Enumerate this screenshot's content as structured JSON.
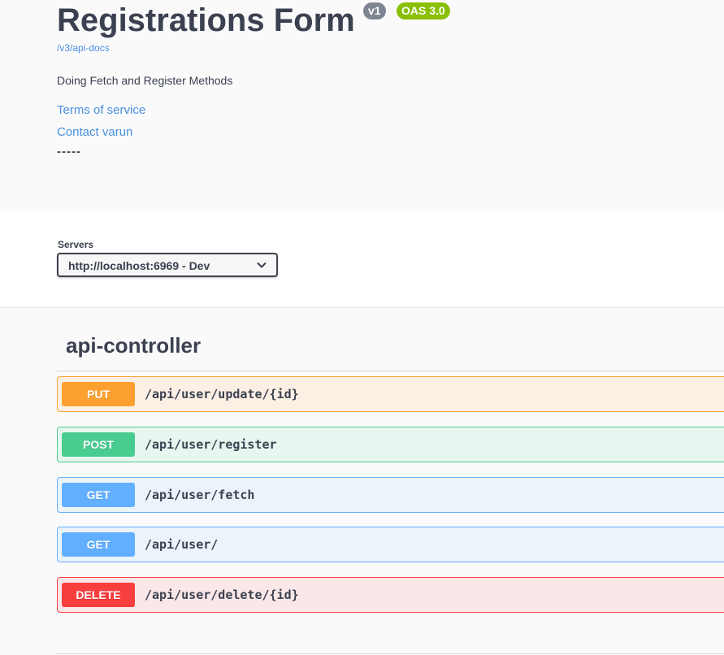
{
  "info": {
    "title": "Registrations Form",
    "version_badge": "v1",
    "oas_badge": "OAS 3.0",
    "docs_link": "/v3/api-docs",
    "description": "Doing Fetch and Register Methods",
    "terms_link": "Terms of service",
    "contact_link": "Contact varun",
    "divider": "-----"
  },
  "servers": {
    "label": "Servers",
    "selected": "http://localhost:6969 - Dev"
  },
  "controller": {
    "title": "api-controller",
    "operations": [
      {
        "method": "PUT",
        "path": "/api/user/update/{id}"
      },
      {
        "method": "POST",
        "path": "/api/user/register"
      },
      {
        "method": "GET",
        "path": "/api/user/fetch"
      },
      {
        "method": "GET",
        "path": "/api/user/"
      },
      {
        "method": "DELETE",
        "path": "/api/user/delete/{id}"
      }
    ]
  },
  "colors": {
    "put": "#fca130",
    "post": "#49cc90",
    "get": "#61affe",
    "delete": "#f93e3e",
    "link": "#4990e2",
    "version_badge": "#7d8492",
    "oas_badge": "#89bf04"
  }
}
